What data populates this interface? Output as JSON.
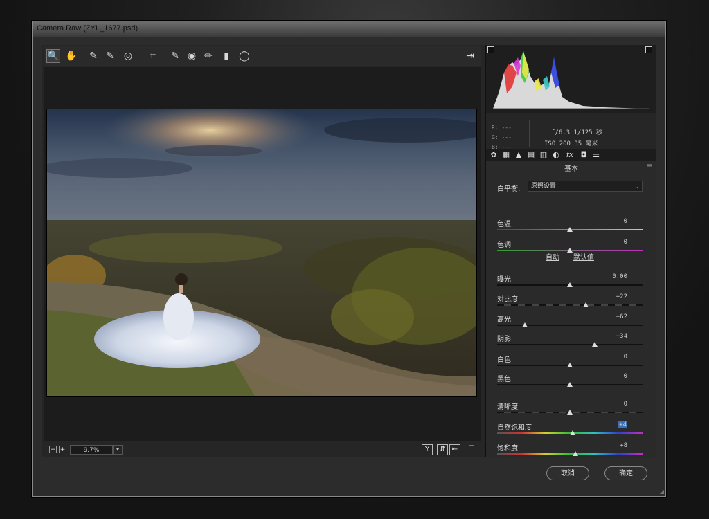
{
  "window": {
    "title": "Camera Raw (ZYL_1677.psd)"
  },
  "toolbar": {
    "tools": [
      {
        "name": "zoom-tool",
        "glyph": "🔍"
      },
      {
        "name": "hand-tool",
        "glyph": "✋"
      },
      {
        "name": "white-balance-tool",
        "glyph": "✎"
      },
      {
        "name": "color-sampler-tool",
        "glyph": "✎"
      },
      {
        "name": "targeted-adjustment-tool",
        "glyph": "◎"
      },
      {
        "name": "crop-tool",
        "glyph": "⌗"
      },
      {
        "name": "spot-removal-tool",
        "glyph": "✎"
      },
      {
        "name": "red-eye-tool",
        "glyph": "◉"
      },
      {
        "name": "adjustment-brush-tool",
        "glyph": "✏"
      },
      {
        "name": "graduated-filter-tool",
        "glyph": "▮"
      },
      {
        "name": "radial-filter-tool",
        "glyph": "◯"
      }
    ],
    "export_glyph": "⇥"
  },
  "bottom": {
    "zoom_value": "9.7%",
    "zoom_out": "−",
    "zoom_in": "+",
    "view_y": "Y",
    "view_swap": "⇵",
    "view_arrow": "⇤",
    "view_settings": "☰"
  },
  "histogram": {
    "r_label": "R: ---",
    "g_label": "G: ---",
    "b_label": "B: ---",
    "exif_line1": "f/6.3  1/125 秒",
    "exif_line2": "ISO 200  35 毫米"
  },
  "panel": {
    "tabs": [
      "✿",
      "▦",
      "▲",
      "▤",
      "▥",
      "◐",
      "fx",
      "◘",
      "☰"
    ],
    "title": "基本",
    "menu_glyph": "≡",
    "white_balance_label": "白平衡:",
    "white_balance_value": "原照设置",
    "auto_label": "自动",
    "default_label": "默认值"
  },
  "sliders": [
    {
      "label": "色温",
      "value": "0",
      "pos": 0.5,
      "track": "temp"
    },
    {
      "label": "色调",
      "value": "0",
      "pos": 0.5,
      "track": "tint"
    },
    {
      "label": "曝光",
      "value": "0.00",
      "pos": 0.5,
      "track": "gray"
    },
    {
      "label": "对比度",
      "value": "+22",
      "pos": 0.61,
      "track": "contrast"
    },
    {
      "label": "高光",
      "value": "−62",
      "pos": 0.19,
      "track": "gray"
    },
    {
      "label": "阴影",
      "value": "+34",
      "pos": 0.67,
      "track": "gray"
    },
    {
      "label": "白色",
      "value": "0",
      "pos": 0.5,
      "track": "gray"
    },
    {
      "label": "黑色",
      "value": "0",
      "pos": 0.5,
      "track": "gray"
    },
    {
      "label": "清晰度",
      "value": "0",
      "pos": 0.5,
      "track": "contrast"
    },
    {
      "label": "自然饱和度",
      "value": "+4",
      "pos": 0.52,
      "track": "sat"
    },
    {
      "label": "饱和度",
      "value": "+8",
      "pos": 0.54,
      "track": "sat"
    }
  ],
  "buttons": {
    "cancel": "取消",
    "ok": "确定"
  }
}
